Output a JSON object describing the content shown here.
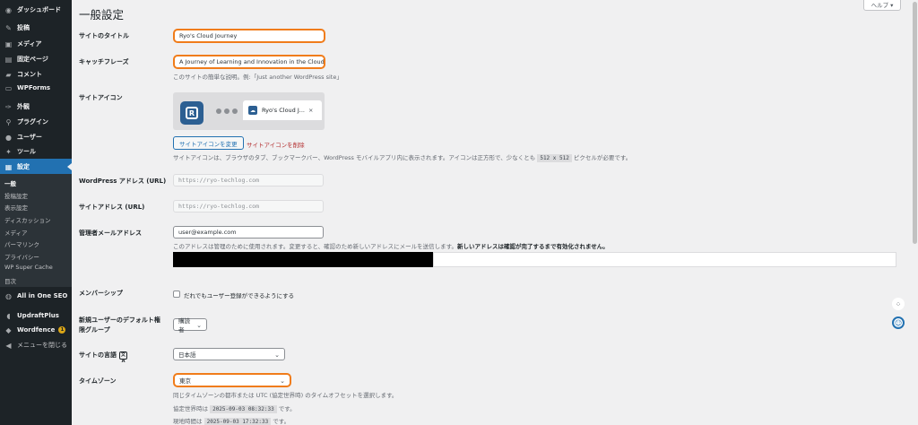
{
  "sidebar": {
    "items": [
      {
        "icon": "dashboard-icon",
        "glyph": "◉",
        "label": "ダッシュボード"
      },
      {
        "icon": "pushpin-icon",
        "glyph": "✎",
        "label": "投稿"
      },
      {
        "icon": "media-icon",
        "glyph": "▣",
        "label": "メディア"
      },
      {
        "icon": "page-icon",
        "glyph": "▤",
        "label": "固定ページ"
      },
      {
        "icon": "comment-icon",
        "glyph": "▰",
        "label": "コメント"
      },
      {
        "icon": "forms-icon",
        "glyph": "▭",
        "label": "WPForms"
      },
      {
        "icon": "brush-icon",
        "glyph": "✑",
        "label": "外観"
      },
      {
        "icon": "plugin-icon",
        "glyph": "⚲",
        "label": "プラグイン"
      },
      {
        "icon": "users-icon",
        "glyph": "●",
        "label": "ユーザー"
      },
      {
        "icon": "wrench-icon",
        "glyph": "✦",
        "label": "ツール"
      },
      {
        "icon": "settings-icon",
        "glyph": "▦",
        "label": "設定"
      },
      {
        "icon": "seo-icon",
        "glyph": "◍",
        "label": "All in One SEO"
      },
      {
        "icon": "updraft-icon",
        "glyph": "◖",
        "label": "UpdraftPlus"
      },
      {
        "icon": "wordfence-icon",
        "glyph": "◆",
        "label": "Wordfence",
        "badge": "1"
      },
      {
        "icon": "collapse-icon",
        "glyph": "◀",
        "label": "メニューを閉じる"
      }
    ],
    "submenu": [
      "一般",
      "投稿設定",
      "表示設定",
      "ディスカッション",
      "メディア",
      "パーマリンク",
      "プライバシー",
      "WP Super Cache",
      "目次"
    ]
  },
  "header": {
    "title": "一般設定",
    "help": "ヘルプ ▾"
  },
  "form": {
    "site_title": {
      "label": "サイトのタイトル",
      "value": "Ryo's Cloud Journey"
    },
    "tagline": {
      "label": "キャッチフレーズ",
      "value": "A Journey of Learning and Innovation in the Cloud",
      "desc": "このサイトの簡単な説明。例:「Just another WordPress site」"
    },
    "site_icon": {
      "label": "サイトアイコン",
      "icon_letter": "R",
      "tab_title": "Ryo's Cloud J...",
      "tab_close": "×",
      "change_button": "サイトアイコンを変更",
      "remove_link": "サイトアイコンを削除",
      "desc_pre": "サイトアイコンは、ブラウザのタブ、ブックマークバー、WordPress モバイルアプリ内に表示されます。アイコンは正方形で、少なくとも",
      "desc_code": "512 x 512",
      "desc_post": "ピクセルが必要です。"
    },
    "wp_address": {
      "label": "WordPress アドレス (URL)",
      "value": "https://ryo-techlog.com"
    },
    "site_address": {
      "label": "サイトアドレス (URL)",
      "value": "https://ryo-techlog.com"
    },
    "admin_email": {
      "label": "管理者メールアドレス",
      "value": "user@example.com",
      "desc": "このアドレスは管理のために使用されます。変更すると、確認のため新しいアドレスにメールを送信します。",
      "desc_bold": "新しいアドレスは確認が完了するまで有効化されません。"
    },
    "membership": {
      "label": "メンバーシップ",
      "checkbox_label": "だれでもユーザー登録ができるようにする",
      "checked": false
    },
    "default_role": {
      "label": "新規ユーザーのデフォルト権限グループ",
      "value": "購読者"
    },
    "site_language": {
      "label": "サイトの言語",
      "lang_icon": "文A",
      "value": "日本語"
    },
    "timezone": {
      "label": "タイムゾーン",
      "value": "東京",
      "desc": "同じタイムゾーンの都市または UTC (協定世界時) のタイムオフセットを選択します。",
      "utc_label": "協定世界時は",
      "utc_value": "2025-09-03 08:32:33",
      "utc_suffix": "です。",
      "local_label": "現地時間は",
      "local_value": "2025-09-03 17:32:33",
      "local_suffix": "です。"
    }
  },
  "floating": {
    "grid_icon": "⁘",
    "assistant_icon": "☺"
  }
}
